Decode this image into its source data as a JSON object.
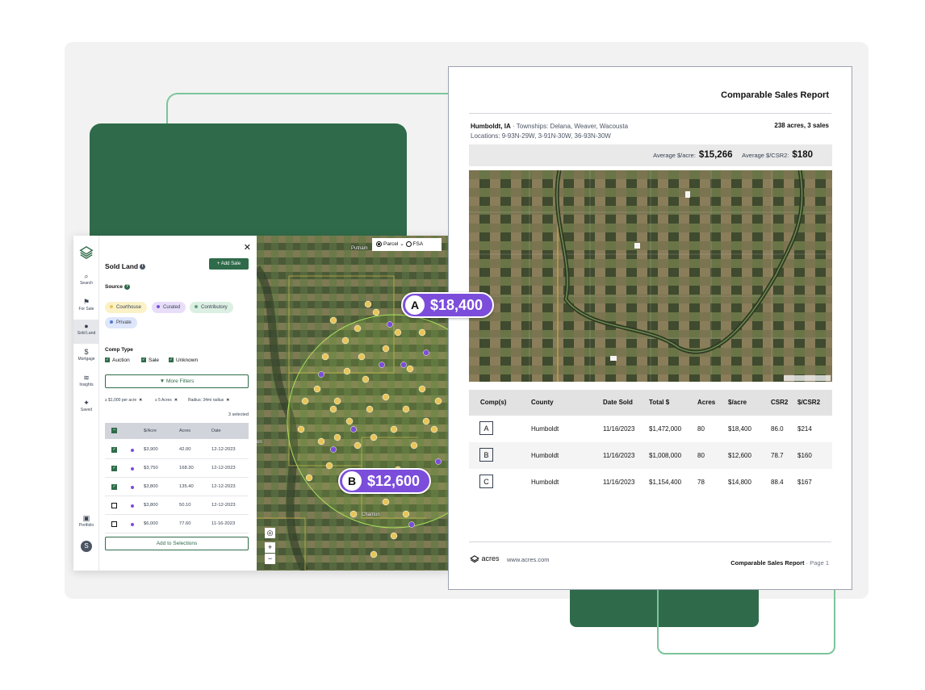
{
  "app": {
    "rail": [
      {
        "label": "Search",
        "icon": "search-icon"
      },
      {
        "label": "For Sale",
        "icon": "flag-icon"
      },
      {
        "label": "Sold Land",
        "icon": "map-pin-icon"
      },
      {
        "label": "Mortgage",
        "icon": "dollar-icon"
      },
      {
        "label": "Insights",
        "icon": "layers-icon"
      },
      {
        "label": "Saved",
        "icon": "pin-icon"
      },
      {
        "label": "Portfolio",
        "icon": "save-icon"
      }
    ],
    "avatar_initial": "S",
    "panel": {
      "title": "Sold Land",
      "add_sale": "+ Add Sale",
      "source_label": "Source",
      "sources": [
        {
          "label": "Courthouse",
          "color": "#e8c55a",
          "bg": "#fbf1c7"
        },
        {
          "label": "Curated",
          "color": "#7c4ddb",
          "bg": "#e8defa"
        },
        {
          "label": "Contributory",
          "color": "#5aa37a",
          "bg": "#dcefe3"
        },
        {
          "label": "Private",
          "color": "#4f7bd9",
          "bg": "#dde6fa"
        }
      ],
      "comp_type_label": "Comp Type",
      "comp_types": [
        "Auction",
        "Sale",
        "Unknown"
      ],
      "more_filters": "More Filters",
      "filter_tags": [
        "≥ $1,000 per acre",
        "≥ 5 Acres",
        "Radius: 34mi radius"
      ],
      "selected_count": "3 selected",
      "table_headers": [
        "$/Acre",
        "Acres",
        "Date"
      ],
      "rows": [
        {
          "checked": true,
          "price": "$3,900",
          "acres": "42.00",
          "date": "12-12-2023"
        },
        {
          "checked": true,
          "price": "$3,750",
          "acres": "168.30",
          "date": "12-12-2023"
        },
        {
          "checked": true,
          "price": "$3,800",
          "acres": "135.40",
          "date": "12-12-2023"
        },
        {
          "checked": false,
          "price": "$3,800",
          "acres": "50.10",
          "date": "12-12-2023"
        },
        {
          "checked": false,
          "price": "$6,000",
          "acres": "77.60",
          "date": "11-16-2023"
        }
      ],
      "add_to_selections": "Add to Selections"
    },
    "map": {
      "layer_options": [
        "Parcel",
        "FSA"
      ],
      "place_labels": [
        "Putnam",
        "Chariton",
        "on"
      ],
      "zoom_in": "+",
      "zoom_out": "−"
    }
  },
  "price_pills": [
    {
      "letter": "A",
      "price": "$18,400"
    },
    {
      "letter": "B",
      "price": "$12,600"
    }
  ],
  "report": {
    "title": "Comparable Sales Report",
    "county": "Humboldt, IA",
    "townships": "· Townships: Delana, Weaver, Wacousta",
    "locations": "Locations: 9-93N-29W, 3-91N-30W, 36-93N-30W",
    "summary": "238 acres, 3 sales",
    "avg_acre_label": "Average $/acre:",
    "avg_acre_value": "$15,266",
    "avg_csr2_label": "Average $/CSR2:",
    "avg_csr2_value": "$180",
    "columns": [
      "Comp(s)",
      "County",
      "Date Sold",
      "Total $",
      "Acres",
      "$/acre",
      "CSR2",
      "$/CSR2"
    ],
    "rows": [
      {
        "comp": "A",
        "county": "Humboldt",
        "date": "11/16/2023",
        "total": "$1,472,000",
        "acres": "80",
        "per_acre": "$18,400",
        "csr2": "86.0",
        "per_csr2": "$214"
      },
      {
        "comp": "B",
        "county": "Humboldt",
        "date": "11/16/2023",
        "total": "$1,008,000",
        "acres": "80",
        "per_acre": "$12,600",
        "csr2": "78.7",
        "per_csr2": "$160"
      },
      {
        "comp": "C",
        "county": "Humboldt",
        "date": "11/16/2023",
        "total": "$1,154,400",
        "acres": "78",
        "per_acre": "$14,800",
        "csr2": "88.4",
        "per_csr2": "$167"
      }
    ],
    "logo_text": "acres",
    "url": "www.acres.com",
    "footer_title": "Comparable Sales Report",
    "footer_page": "· Page 1"
  }
}
